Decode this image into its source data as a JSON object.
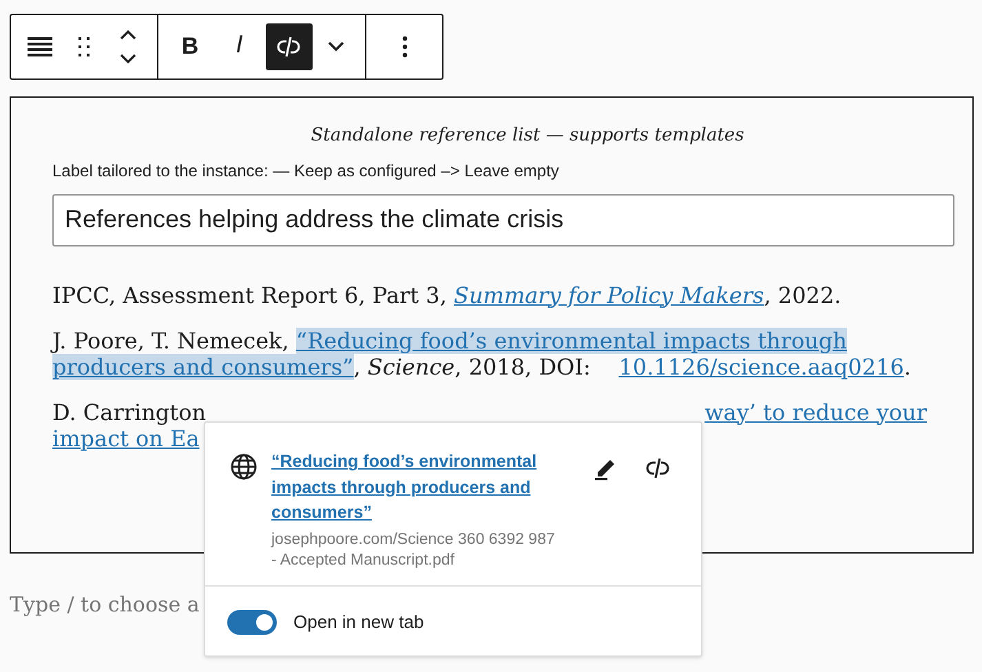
{
  "toolbar": {
    "format_buttons": [
      {
        "kind": "bold",
        "label": "B",
        "selected": false
      },
      {
        "kind": "italic",
        "label": "I",
        "selected": false
      },
      {
        "kind": "link",
        "selected": true
      }
    ]
  },
  "block": {
    "caption": "Standalone reference list — supports templates",
    "label": "Label tailored to the instance: — Keep as configured –> Leave empty",
    "heading_field": {
      "value": "References helping address the climate crisis"
    },
    "references": [
      {
        "lines": [
          [
            {
              "kind": "text",
              "text": "IPCC, Assessment Report 6, Part 3, "
            },
            {
              "kind": "italic_link",
              "text": "Summary for Policy Makers"
            },
            {
              "kind": "text",
              "text": ", 2022."
            }
          ]
        ]
      },
      {
        "lines": [
          [
            {
              "kind": "text",
              "text": "J. Poore, T. Nemecek, "
            },
            {
              "kind": "selected_link",
              "text": "“Reducing food’s environmental impacts through"
            }
          ],
          [
            {
              "kind": "selected_link",
              "text": "producers and consumers”"
            },
            {
              "kind": "text",
              "text": ", *Science*, 2018, DOI:    "
            },
            {
              "kind": "link",
              "text": "10.1126/science.aaq0216"
            },
            {
              "kind": "text",
              "text": "."
            }
          ]
        ]
      },
      {
        "lines": [
          [
            {
              "kind": "text",
              "text": "D. Carrington"
            },
            {
              "kind": "link",
              "text": "way’ to reduce your",
              "gap": true
            }
          ],
          [
            {
              "kind": "link",
              "text": "impact on Ea"
            }
          ]
        ]
      }
    ]
  },
  "placeholder": "Type / to choose a",
  "link_popover": {
    "title": "“Reducing food’s environmental impacts through producers and consumers”",
    "url": "josephpoore.com/Science 360 6392 987 - Accepted Manuscript.pdf",
    "toggle": {
      "label": "Open in new tab",
      "on": true
    }
  }
}
